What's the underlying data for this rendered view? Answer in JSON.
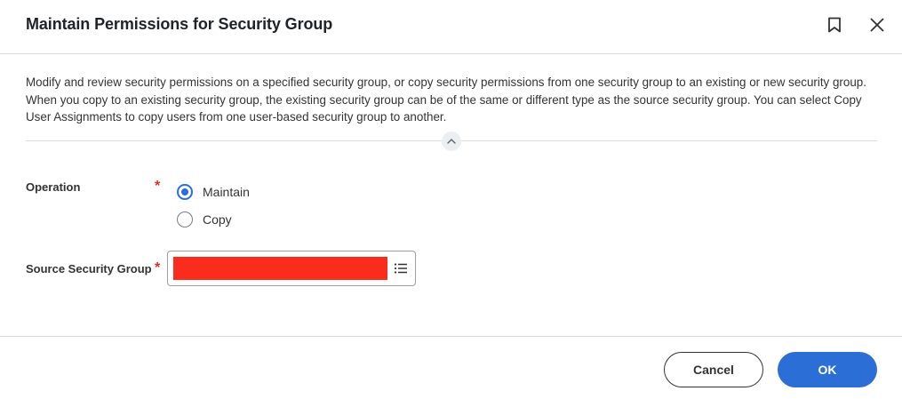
{
  "dialog": {
    "title": "Maintain Permissions for Security Group",
    "bookmark_icon": "bookmark-icon",
    "close_icon": "close-icon",
    "description": "Modify and review security permissions on a specified security group, or copy security permissions from one security group to an existing or new security group. When you copy to an existing security group, the existing security group can be of the same or different type as the source security group. You can select Copy User Assignments to copy users from one user-based security group to another.",
    "collapse_icon": "chevron-up-icon"
  },
  "form": {
    "operation": {
      "label": "Operation",
      "required_mark": "*",
      "options": [
        {
          "label": "Maintain",
          "selected": true
        },
        {
          "label": "Copy",
          "selected": false
        }
      ]
    },
    "source_security_group": {
      "label": "Source Security Group",
      "required_mark": "*",
      "value_redacted": true,
      "redaction_color": "#f92c1e",
      "prompt_icon": "prompt-list-icon"
    }
  },
  "footer": {
    "cancel_label": "Cancel",
    "ok_label": "OK"
  },
  "colors": {
    "primary": "#2a6ed6",
    "required": "#de2e21",
    "text": "#333333"
  }
}
